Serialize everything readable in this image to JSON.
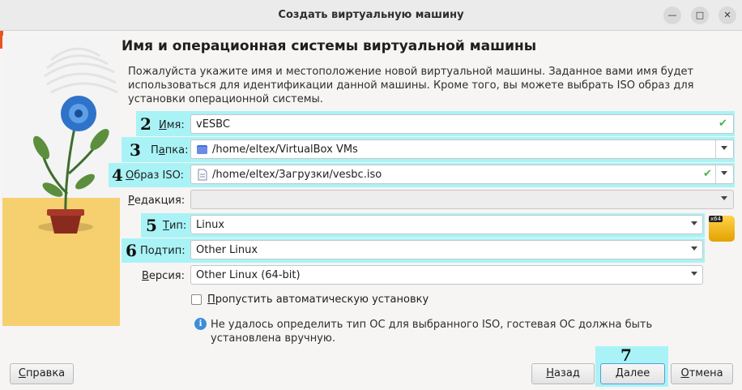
{
  "window": {
    "title": "Создать виртуальную машину"
  },
  "page": {
    "heading": "Имя и операционная системы виртуальной машины",
    "description": "Пожалуйста укажите имя и местоположение новой виртуальной машины. Заданное вами имя будет использоваться для идентификации данной машины. Кроме того, вы можете выбрать ISO образ для установки операционной системы."
  },
  "annotations": [
    "2",
    "3",
    "4",
    "5",
    "6",
    "7"
  ],
  "form": {
    "name": {
      "label_u": "И",
      "label_rest": "мя:",
      "value": "vESBC"
    },
    "folder": {
      "label_pre": "П",
      "label_u": "а",
      "label_rest": "пка:",
      "value": "/home/eltex/VirtualBox VMs",
      "icon": "folder-icon"
    },
    "iso": {
      "label_u": "О",
      "label_rest": "браз ISO:",
      "value": "/home/eltex/Загрузки/vesbc.iso",
      "icon": "file-icon"
    },
    "edition": {
      "label_u": "Р",
      "label_rest": "едакция:",
      "value": ""
    },
    "type": {
      "label_u": "Т",
      "label_rest": "ип:",
      "value": "Linux"
    },
    "subtype": {
      "label_pre": "По",
      "label_u": "д",
      "label_rest": "тип:",
      "value": "Other Linux"
    },
    "version": {
      "label_u": "В",
      "label_rest": "ерсия:",
      "value": "Other Linux (64-bit)"
    },
    "os_badge": "x64",
    "skip_unattended": {
      "label_u": "П",
      "label_rest": "ропустить автоматическую установку",
      "checked": false
    },
    "info": "Не удалось определить тип ОС для выбранного ISO, гостевая ОС должна быть установлена вручную."
  },
  "buttons": {
    "help": {
      "label_pre": "",
      "label_u": "С",
      "label_rest": "правка"
    },
    "back": {
      "label_pre": "",
      "label_u": "Н",
      "label_rest": "азад"
    },
    "next": {
      "label_pre": "",
      "label_u": "Д",
      "label_rest": "алее"
    },
    "cancel": {
      "label_pre": "",
      "label_u": "О",
      "label_rest": "тмена"
    }
  },
  "colors": {
    "highlight": "#a9f3f6",
    "accent": "#e95420",
    "check": "#4caf50"
  }
}
